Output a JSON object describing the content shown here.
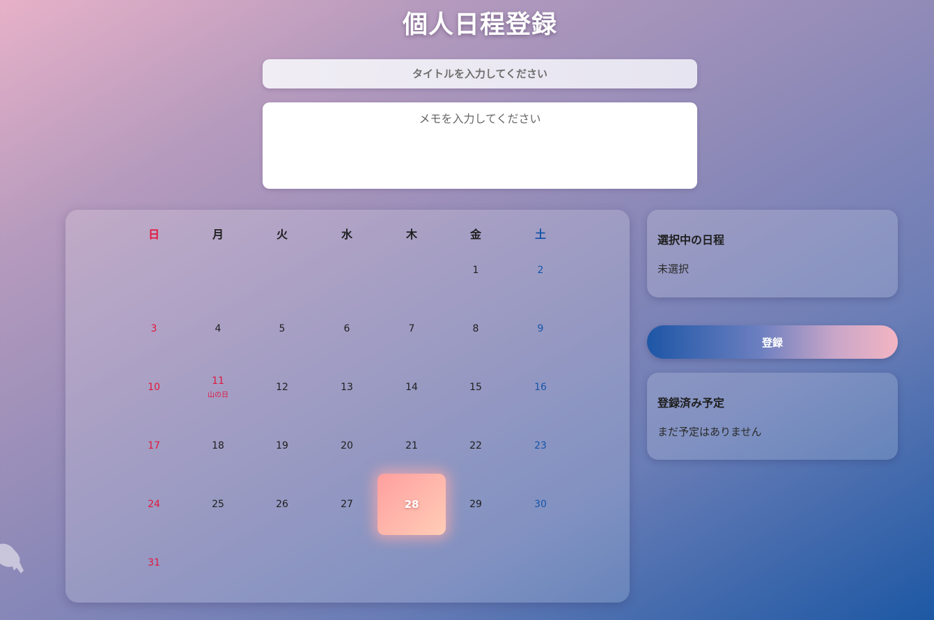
{
  "page": {
    "title": "個人日程登録"
  },
  "form": {
    "title_placeholder": "タイトルを入力してください",
    "title_value": "",
    "memo_placeholder": "メモを入力してください",
    "memo_value": ""
  },
  "calendar": {
    "weekdays": [
      "日",
      "月",
      "火",
      "水",
      "木",
      "金",
      "土"
    ],
    "days": [
      "1",
      "2",
      "3",
      "4",
      "5",
      "6",
      "7",
      "8",
      "9",
      "10",
      "11",
      "12",
      "13",
      "14",
      "15",
      "16",
      "17",
      "18",
      "19",
      "20",
      "21",
      "22",
      "23",
      "24",
      "25",
      "26",
      "27",
      "28",
      "29",
      "30",
      "31"
    ],
    "first_weekday_index": 5,
    "holidays": [
      {
        "day": "11",
        "label": "山の日"
      }
    ],
    "today": "28",
    "colors": {
      "sunday": "#e2173e",
      "saturday": "#1555a8",
      "today_gradient_start": "#ff9f9f",
      "today_gradient_end": "#ffcdb7"
    }
  },
  "selected": {
    "heading": "選択中の日程",
    "value": "未選択"
  },
  "register_button": {
    "label": "登録"
  },
  "registered": {
    "heading": "登録済み予定",
    "empty_text": "まだ予定はありません"
  },
  "decor": {
    "icon": "elephant-silhouette-icon"
  }
}
